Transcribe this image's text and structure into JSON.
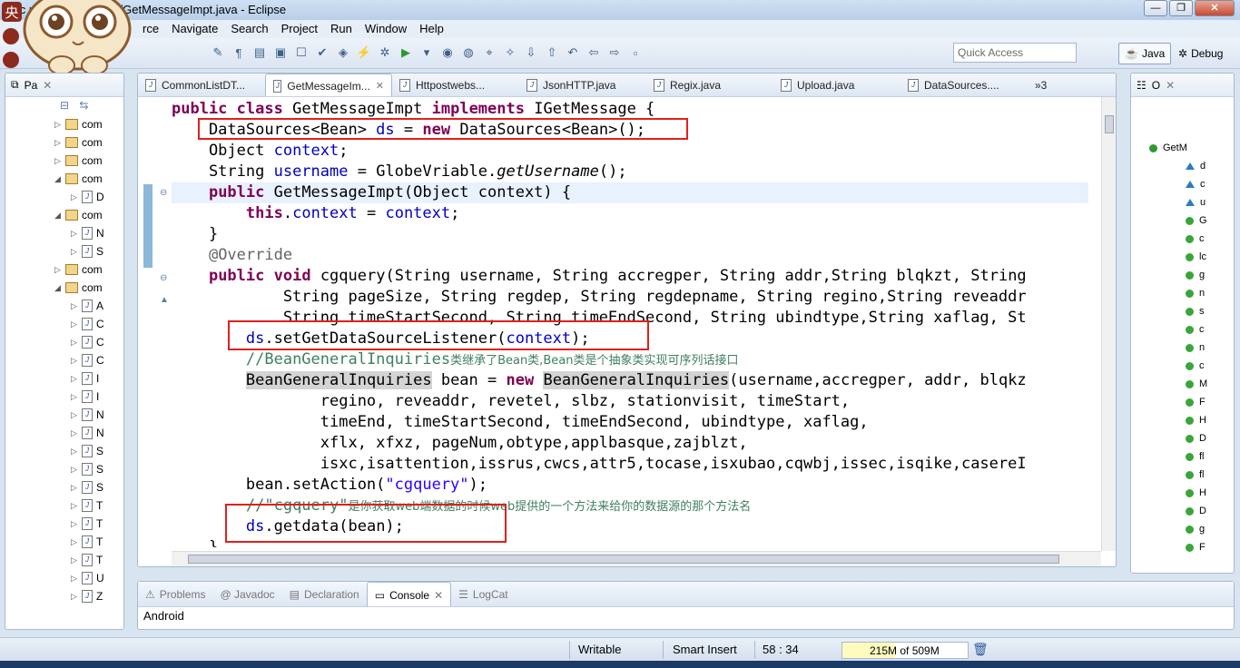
{
  "window": {
    "title": "avc                ryfront/gsoa/Json/GetMessageImpt.java - Eclipse",
    "controls": [
      "—",
      "❐",
      "✕"
    ]
  },
  "menu": [
    "rce",
    "Navigate",
    "Search",
    "Project",
    "Run",
    "Window",
    "Help"
  ],
  "toolbar": {
    "quick_access_placeholder": "Quick Access",
    "perspectives": [
      "Java",
      "Debug"
    ]
  },
  "mascot": {
    "badge": "央"
  },
  "package_explorer": {
    "tab_label": "Pa",
    "rows": [
      {
        "kind": "pkg",
        "label": "com",
        "arrow": "▷"
      },
      {
        "kind": "pkg",
        "label": "com",
        "arrow": "▷"
      },
      {
        "kind": "pkg",
        "label": "com",
        "arrow": "▷"
      },
      {
        "kind": "pkg",
        "label": "com",
        "arrow": "◢"
      },
      {
        "kind": "file",
        "label": "D",
        "arrow": "▷"
      },
      {
        "kind": "pkg",
        "label": "com",
        "arrow": "◢"
      },
      {
        "kind": "file",
        "label": "N",
        "arrow": "▷"
      },
      {
        "kind": "file",
        "label": "S",
        "arrow": "▷"
      },
      {
        "kind": "pkg",
        "label": "com",
        "arrow": "▷"
      },
      {
        "kind": "pkg",
        "label": "com",
        "arrow": "◢"
      },
      {
        "kind": "file",
        "label": "A",
        "arrow": "▷"
      },
      {
        "kind": "file",
        "label": "C",
        "arrow": "▷"
      },
      {
        "kind": "file",
        "label": "C",
        "arrow": "▷"
      },
      {
        "kind": "file",
        "label": "C",
        "arrow": "▷"
      },
      {
        "kind": "file",
        "label": "I",
        "arrow": "▷"
      },
      {
        "kind": "file",
        "label": "I",
        "arrow": "▷"
      },
      {
        "kind": "file",
        "label": "N",
        "arrow": "▷"
      },
      {
        "kind": "file",
        "label": "N",
        "arrow": "▷"
      },
      {
        "kind": "file",
        "label": "S",
        "arrow": "▷"
      },
      {
        "kind": "file",
        "label": "S",
        "arrow": "▷"
      },
      {
        "kind": "file",
        "label": "S",
        "arrow": "▷"
      },
      {
        "kind": "file",
        "label": "T",
        "arrow": "▷"
      },
      {
        "kind": "file",
        "label": "T",
        "arrow": "▷"
      },
      {
        "kind": "file",
        "label": "T",
        "arrow": "▷"
      },
      {
        "kind": "file",
        "label": "T",
        "arrow": "▷"
      },
      {
        "kind": "file",
        "label": "U",
        "arrow": "▷"
      },
      {
        "kind": "file",
        "label": "Z",
        "arrow": "▷"
      }
    ]
  },
  "editor": {
    "tabs": [
      {
        "label": "CommonListDT...",
        "active": false
      },
      {
        "label": "GetMessageIm...",
        "active": true
      },
      {
        "label": "Httpostwebs...",
        "active": false
      },
      {
        "label": "JsonHTTP.java",
        "active": false
      },
      {
        "label": "Regix.java",
        "active": false
      },
      {
        "label": "Upload.java",
        "active": false
      },
      {
        "label": "DataSources....",
        "active": false
      }
    ],
    "overflow_count": "»3",
    "code_lines": [
      "public class GetMessageImpt implements IGetMessage {",
      "    DataSources<Bean> ds = new DataSources<Bean>();",
      "    Object context;",
      "    String username = GlobeVriable.getUsername();",
      "    public GetMessageImpt(Object context) {",
      "        this.context = context;",
      "    }",
      "    @Override",
      "    public void cgquery(String username, String accregper, String addr,String blqkzt, String",
      "            String pageSize, String regdep, String regdepname, String regino,String reveaddr",
      "            String timeStartSecond, String timeEndSecond, String ubindtype,String xaflag, St",
      "        ds.setGetDataSourceListener(context);",
      "        //BeanGeneralInquiries类继承了Bean类,Bean类是个抽象类实现可序列话接口",
      "        BeanGeneralInquiries bean = new BeanGeneralInquiries(username,accregper, addr, blqkz",
      "                regino, reveaddr, revetel, slbz, stationvisit, timeStart,",
      "                timeEnd, timeStartSecond, timeEndSecond, ubindtype, xaflag,",
      "                xflx, xfxz, pageNum,obtype,applbasque,zajblzt,",
      "                isxc,isattention,issrus,cwcs,attr5,tocase,isxubao,cqwbj,issec,isqike,casereI",
      "        bean.setAction(\"cgquery\");",
      "        //\"cgquery\"是你获取web端数据的时候web提供的一个方法来给你的数据源的那个方法名",
      "        ds.getdata(bean);",
      "    }"
    ]
  },
  "outline": {
    "tab_label": "O",
    "root": "GetM",
    "items": [
      {
        "kind": "field",
        "label": "d"
      },
      {
        "kind": "field",
        "label": "c"
      },
      {
        "kind": "field",
        "label": "u"
      },
      {
        "kind": "ctor",
        "label": "G"
      },
      {
        "kind": "method",
        "label": "c"
      },
      {
        "kind": "method",
        "label": "lc"
      },
      {
        "kind": "method",
        "label": "g"
      },
      {
        "kind": "method",
        "label": "n"
      },
      {
        "kind": "method",
        "label": "s"
      },
      {
        "kind": "method",
        "label": "c"
      },
      {
        "kind": "method",
        "label": "n"
      },
      {
        "kind": "method",
        "label": "c"
      },
      {
        "kind": "method",
        "label": "M"
      },
      {
        "kind": "method",
        "label": "F"
      },
      {
        "kind": "method",
        "label": "H"
      },
      {
        "kind": "method",
        "label": "D"
      },
      {
        "kind": "method",
        "label": "fl"
      },
      {
        "kind": "method",
        "label": "fl"
      },
      {
        "kind": "method",
        "label": "H"
      },
      {
        "kind": "method",
        "label": "D"
      },
      {
        "kind": "method",
        "label": "g"
      },
      {
        "kind": "method",
        "label": "F"
      }
    ]
  },
  "bottom_panel": {
    "tabs": [
      {
        "label": "Problems",
        "icon": "problems-icon",
        "active": false
      },
      {
        "label": "@ Javadoc",
        "icon": "javadoc-icon",
        "active": false
      },
      {
        "label": "Declaration",
        "icon": "declaration-icon",
        "active": false
      },
      {
        "label": "Console",
        "icon": "console-icon",
        "active": true
      },
      {
        "label": "LogCat",
        "icon": "logcat-icon",
        "active": false
      }
    ],
    "console_text": "Android"
  },
  "status_bar": {
    "writable": "Writable",
    "insert_mode": "Smart Insert",
    "position": "58 : 34",
    "heap": "215M of 509M",
    "heap_used_mb": 215,
    "heap_total_mb": 509
  },
  "colors": {
    "keyword": "#7f0055",
    "field": "#0000c0",
    "string": "#2a00ff",
    "comment": "#3f7f5f",
    "annotation_box": "#e0201c"
  }
}
